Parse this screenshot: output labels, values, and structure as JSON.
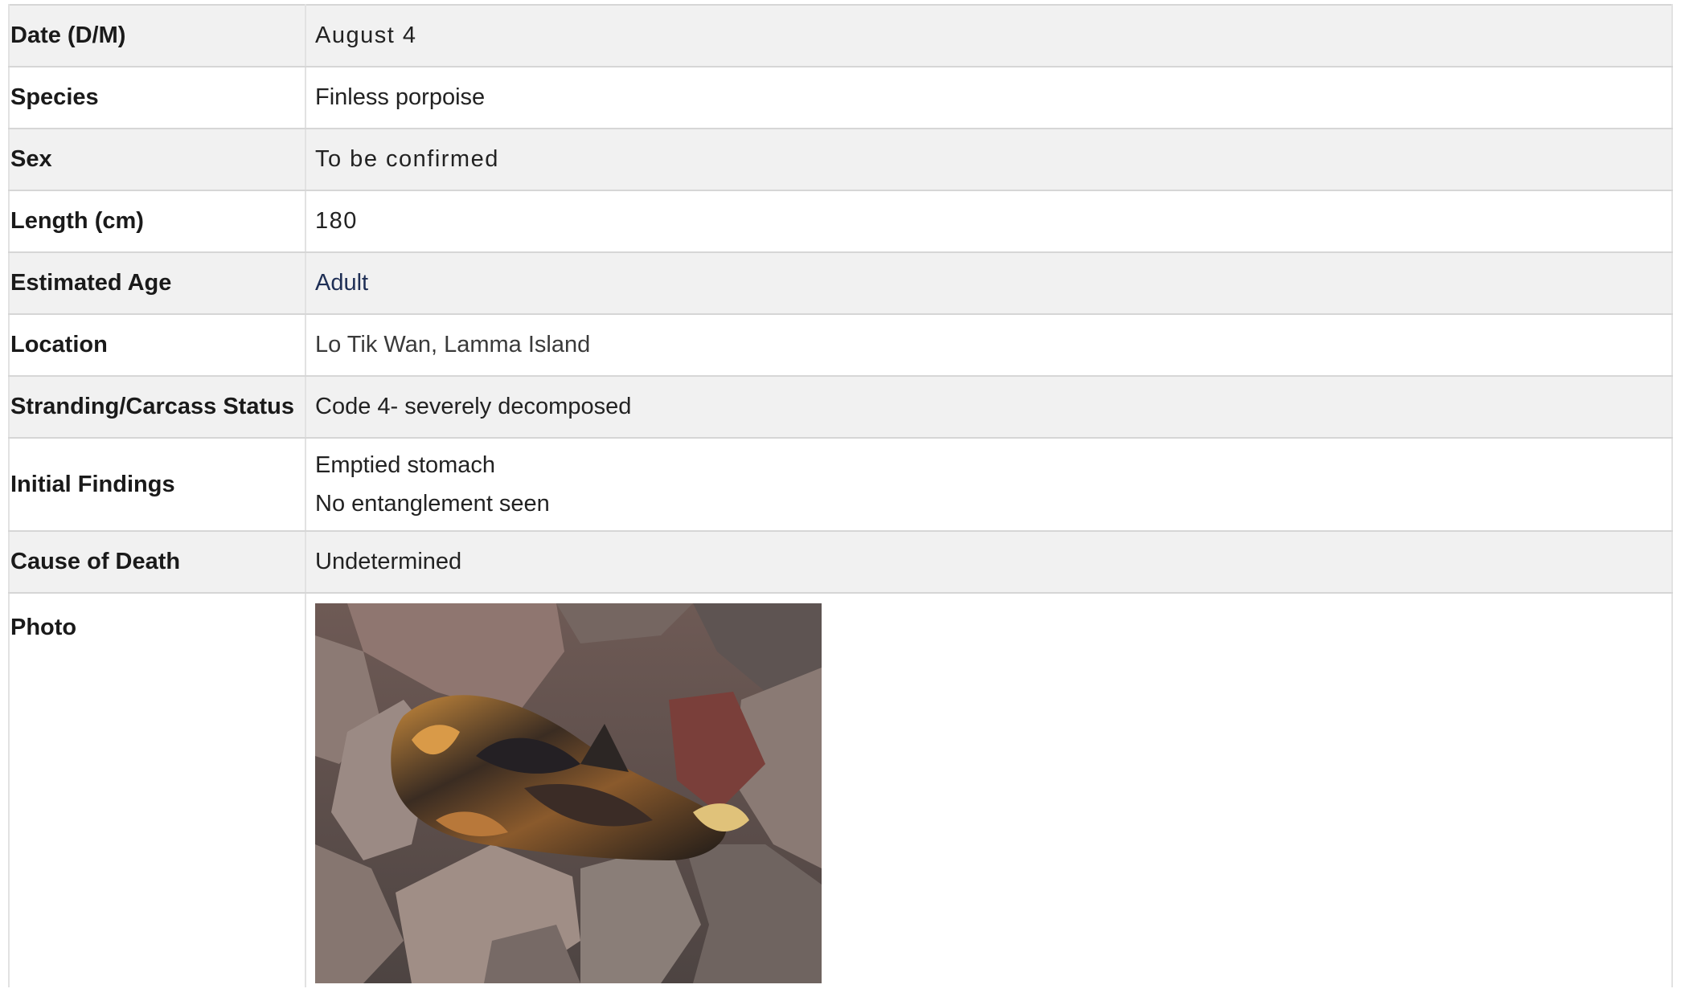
{
  "rows": [
    {
      "label": "Date (D/M)",
      "value": "August 4"
    },
    {
      "label": "Species",
      "value": "Finless porpoise"
    },
    {
      "label": "Sex",
      "value": "To be confirmed"
    },
    {
      "label": "Length (cm)",
      "value": "180"
    },
    {
      "label": "Estimated Age",
      "value": "Adult"
    },
    {
      "label": "Location",
      "value": "Lo Tik Wan, Lamma Island"
    },
    {
      "label": "Stranding/Carcass Status",
      "value": "Code 4- severely decomposed"
    },
    {
      "label": "Initial Findings",
      "lines": [
        "Emptied stomach",
        "No entanglement seen"
      ]
    },
    {
      "label": "Cause of Death",
      "value": "Undetermined"
    },
    {
      "label": "Photo"
    }
  ],
  "colors": {
    "row_shade": "#f1f1f1",
    "border": "#d6d6d6",
    "age_text": "#1f2f55"
  }
}
